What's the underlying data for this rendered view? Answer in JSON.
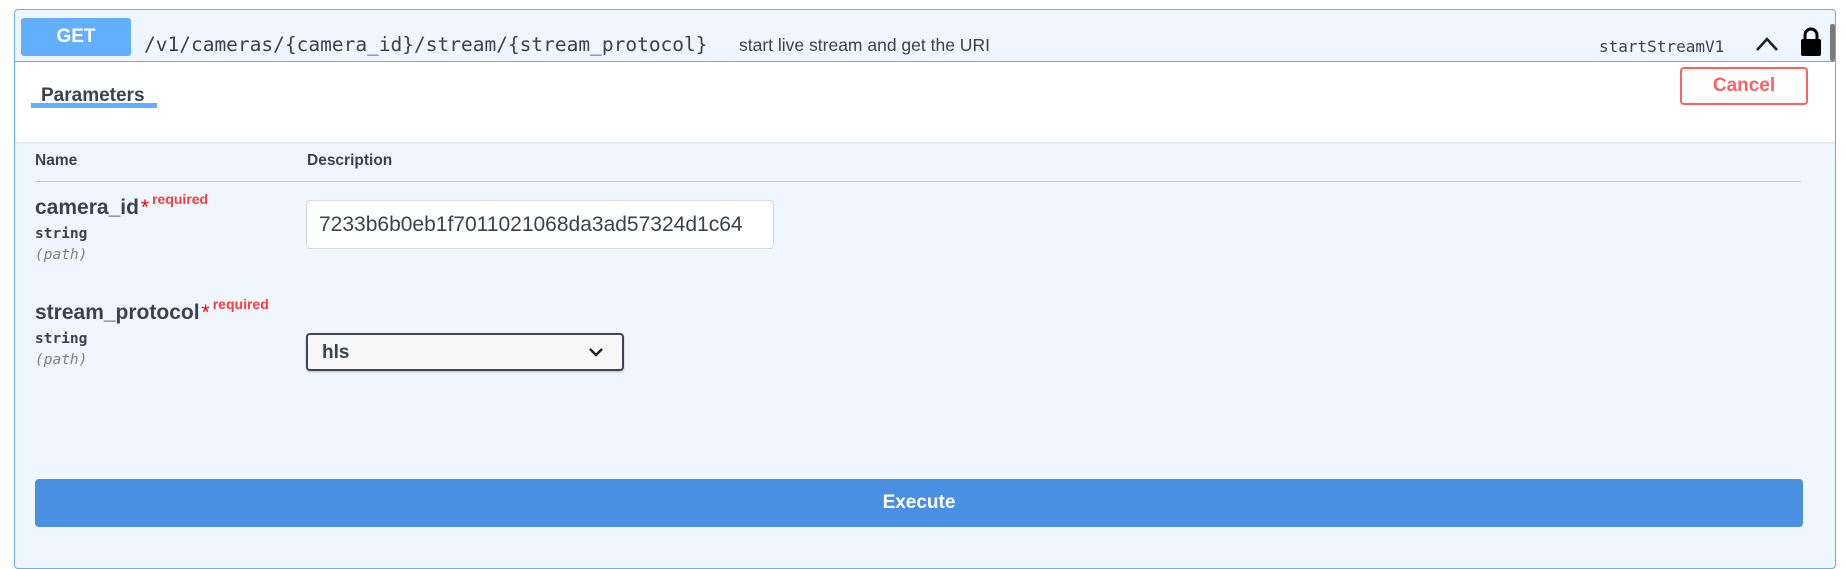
{
  "operation": {
    "method": "GET",
    "path": "/v1/cameras/{camera_id}/stream/{stream_protocol}",
    "summary": "start live stream and get the URI",
    "operation_id": "startStreamV1"
  },
  "tabs": {
    "parameters_label": "Parameters",
    "cancel_label": "Cancel"
  },
  "table": {
    "col_name": "Name",
    "col_description": "Description"
  },
  "parameters": [
    {
      "name": "camera_id",
      "star": "*",
      "required_label": "required",
      "type": "string",
      "location": "(path)",
      "value": "7233b6b0eb1f7011021068da3ad57324d1c64"
    },
    {
      "name": "stream_protocol",
      "star": "*",
      "required_label": "required",
      "type": "string",
      "location": "(path)",
      "selected_option": "hls"
    }
  ],
  "execute_label": "Execute",
  "icons": {
    "collapse": "chevron-up-icon",
    "auth": "lock-icon",
    "select_arrow": "chevron-down-icon"
  },
  "colors": {
    "get_accent": "#61affe",
    "block_bg": "#eff6ff",
    "cancel_red": "#ff6060",
    "execute_blue": "#4990e2",
    "required_red": "#ff3b3b"
  }
}
